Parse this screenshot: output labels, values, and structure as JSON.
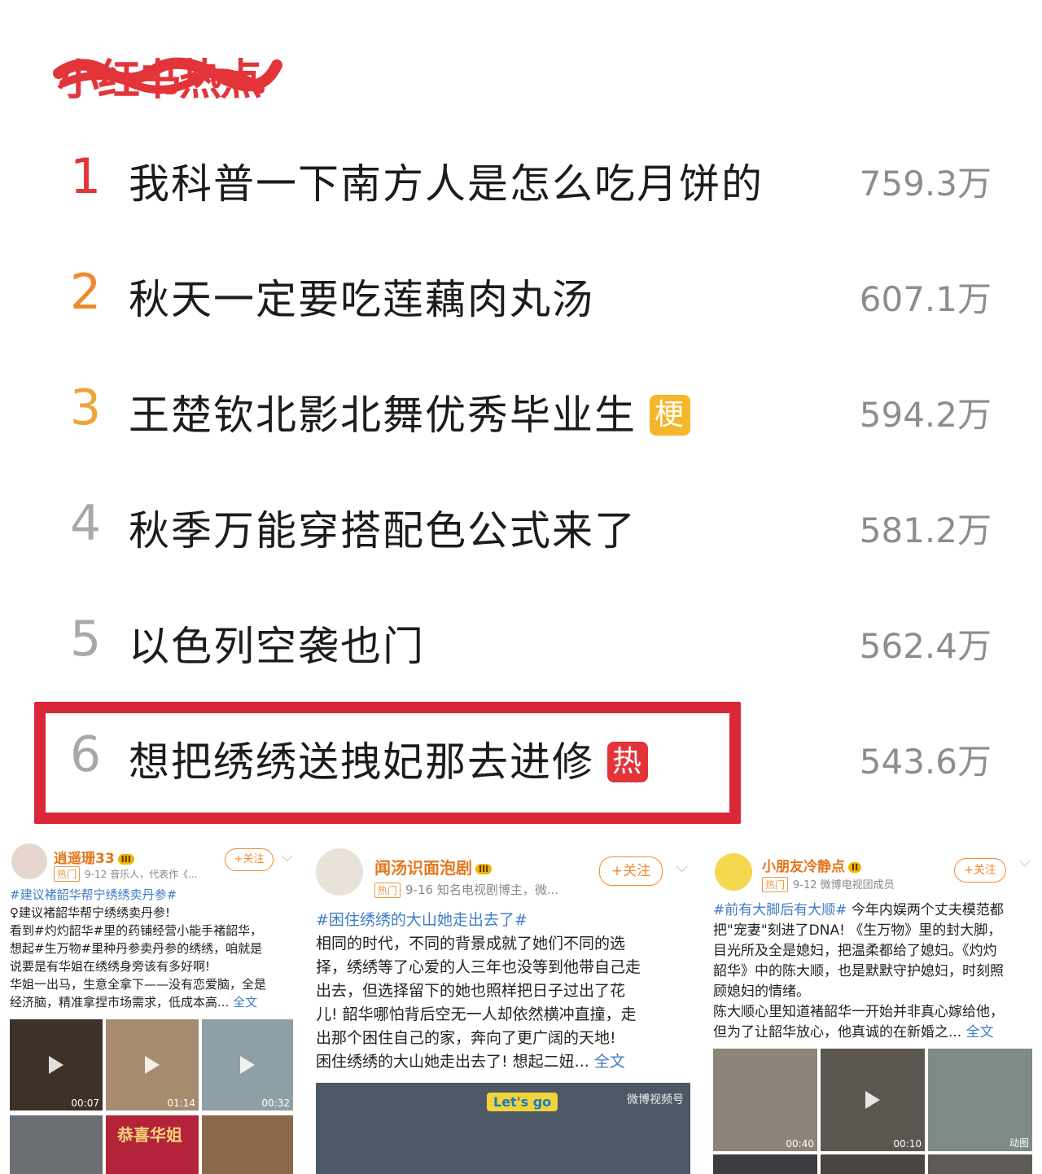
{
  "header": {
    "title": "小红书热点"
  },
  "rankings": [
    {
      "rank": "1",
      "title": "我科普一下南方人是怎么吃月饼的",
      "value": "759.3万",
      "badge": "",
      "rank_color": "#e3343a"
    },
    {
      "rank": "2",
      "title": "秋天一定要吃莲藕肉丸汤",
      "value": "607.1万",
      "badge": "",
      "rank_color": "#f0892e"
    },
    {
      "rank": "3",
      "title": "王楚钦北影北舞优秀毕业生",
      "value": "594.2万",
      "badge": "梗",
      "rank_color": "#f0a23a"
    },
    {
      "rank": "4",
      "title": "秋季万能穿搭配色公式来了",
      "value": "581.2万",
      "badge": "",
      "rank_color": "#a8a8a8"
    },
    {
      "rank": "5",
      "title": "以色列空袭也门",
      "value": "562.4万",
      "badge": "",
      "rank_color": "#a8a8a8"
    },
    {
      "rank": "6",
      "title": "想把绣绣送拽妃那去进修",
      "value": "543.6万",
      "badge": "热",
      "rank_color": "#a8a8a8"
    }
  ],
  "cards": [
    {
      "username": "逍遥珊33",
      "vip": "III",
      "hot_tag": "热门",
      "date": "9-12",
      "desc": "音乐人，代表作《...",
      "follow": "+关注",
      "topic": "#建议褚韶华帮宁绣绣卖丹参#",
      "lines": [
        "♀建议褚韶华帮宁绣绣卖丹参!",
        "看到#灼灼韶华#里的药铺经营小能手褚韶华，",
        "想起#生万物#里种丹参卖丹参的绣绣，咱就是",
        "说要是有华姐在绣绣身旁该有多好啊!",
        "华姐一出马，生意全拿下——没有恋爱脑，全是",
        "经济脑，精准拿捏市场需求，低成本高..."
      ],
      "more": "全文",
      "times": [
        "00:07",
        "01:14",
        "00:32"
      ],
      "banner": "恭喜华姐"
    },
    {
      "username": "闻汤识面泡剧",
      "vip": "III",
      "hot_tag": "热门",
      "date": "9-16",
      "desc": "知名电视剧博主，微...",
      "follow": "+关注",
      "topic": "#困住绣绣的大山她走出去了#",
      "lines": [
        "相同的时代，不同的背景成就了她们不同的选",
        "择，绣绣等了心爱的人三年也没等到他带自己走",
        "出去，但选择留下的她也照样把日子过出了花",
        "儿! 韶华哪怕背后空无一人却依然横冲直撞，走",
        "出那个困住自己的家，奔向了更广阔的天地!",
        "困住绣绣的大山她走出去了! 想起二妞..."
      ],
      "more": "全文",
      "watermark": "微博视频号",
      "sticker": "Let's go"
    },
    {
      "username": "小朋友冷静点",
      "vip": "II",
      "hot_tag": "热门",
      "date": "9-12",
      "desc": "微博电视团成员",
      "follow": "+关注",
      "topic": "#前有大脚后有大顺#",
      "lines": [
        "今年内娱两个丈夫模范都",
        "把\"宠妻\"刻进了DNA! 《生万物》里的封大脚，",
        "目光所及全是媳妇，把温柔都给了媳妇。《灼灼",
        "韶华》中的陈大顺，也是默默守护媳妇，时刻照",
        "顾媳妇的情绪。",
        "陈大顺心里知道褚韶华一开始并非真心嫁给他，",
        "但为了让韶华放心，他真诚的在新婚之..."
      ],
      "more": "全文",
      "times": [
        "00:40",
        "00:10",
        "动图"
      ]
    }
  ]
}
